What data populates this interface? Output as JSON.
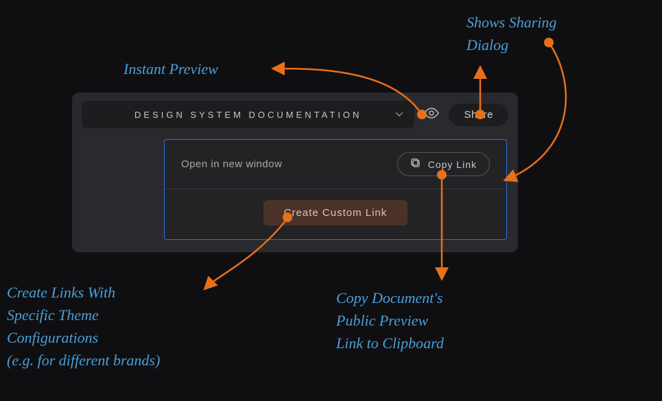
{
  "annotations": {
    "sharingDialog": "Shows Sharing\nDialog",
    "instantPreview": "Instant Preview",
    "createLinks": "Create Links With\nSpecific Theme\nConfigurations\n(e.g. for different brands)",
    "copyDoc": "Copy Document's\nPublic Preview\nLink to Clipboard"
  },
  "panel": {
    "docTitle": "DESIGN  SYSTEM  DOCUMENTATION",
    "shareLabel": "Share",
    "popover": {
      "openLabel": "Open in new window",
      "copyLinkLabel": "Copy  Link",
      "createCustomLabel": "Create Custom Link"
    }
  },
  "colors": {
    "annotation": "#4a9fd8",
    "arrow": "#e8701a",
    "popoverBorder": "#2d6fe0"
  }
}
